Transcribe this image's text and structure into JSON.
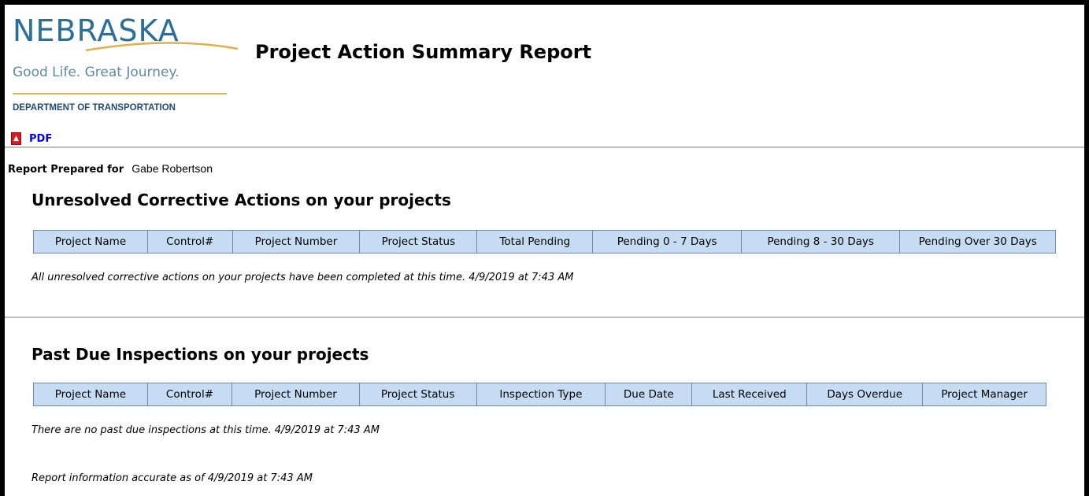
{
  "header": {
    "logo_word": "NEBRASKA",
    "logo_tagline": "Good Life. Great Journey.",
    "logo_department": "DEPARTMENT OF TRANSPORTATION",
    "title": "Project Action Summary Report",
    "pdf_label": "PDF"
  },
  "prepared": {
    "label": "Report Prepared for",
    "name": "Gabe Robertson"
  },
  "corrective": {
    "title": "Unresolved Corrective Actions on your projects",
    "columns": [
      "Project Name",
      "Control#",
      "Project Number",
      "Project Status",
      "Total Pending",
      "Pending 0 - 7 Days",
      "Pending 8 - 30 Days",
      "Pending Over 30 Days"
    ],
    "message": "All unresolved corrective actions on your projects have been completed at this time. 4/9/2019 at 7:43 AM"
  },
  "inspections": {
    "title": "Past Due Inspections on your projects",
    "columns": [
      "Project Name",
      "Control#",
      "Project Number",
      "Project Status",
      "Inspection Type",
      "Due Date",
      "Last Received",
      "Days Overdue",
      "Project Manager"
    ],
    "message": "There are no past due inspections at this time. 4/9/2019 at 7:43 AM"
  },
  "footer": {
    "accuracy": "Report information accurate as of 4/9/2019 at 7:43 AM"
  },
  "colors": {
    "header_cell_bg": "#c5dcf2",
    "link": "#0000ee",
    "logo_blue": "#2a6f9a",
    "logo_gold": "#e2b04a"
  }
}
